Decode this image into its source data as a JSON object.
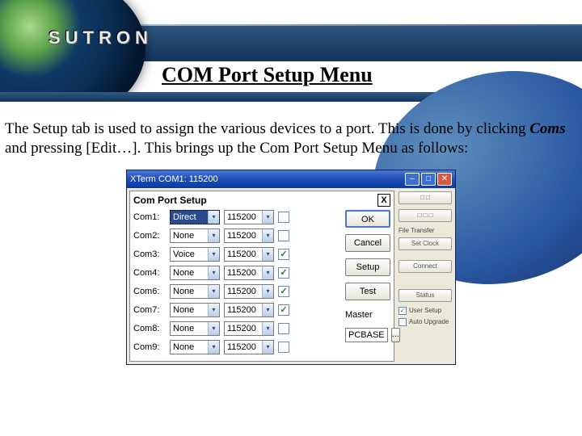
{
  "brand": "SUTRON",
  "slide_title": "COM Port Setup Menu",
  "body_text_pre": "The Setup tab is used to assign the various devices to a port. This is done by clicking ",
  "body_text_ital": "Coms",
  "body_text_post": " and pressing [Edit…]. This brings up the Com Port Setup Menu as follows:",
  "window": {
    "title": "XTerm COM1: 115200",
    "dialog_title": "Com Port Setup",
    "close_glyph": "X",
    "triangle": "▾",
    "check": "✓",
    "rows": [
      {
        "label": "Com1:",
        "type": "Direct",
        "baud": "115200",
        "checked": false,
        "selected": true
      },
      {
        "label": "Com2:",
        "type": "None",
        "baud": "115200",
        "checked": false,
        "selected": false
      },
      {
        "label": "Com3:",
        "type": "Voice",
        "baud": "115200",
        "checked": true,
        "selected": false
      },
      {
        "label": "Com4:",
        "type": "None",
        "baud": "115200",
        "checked": true,
        "selected": false
      },
      {
        "label": "Com6:",
        "type": "None",
        "baud": "115200",
        "checked": true,
        "selected": false
      },
      {
        "label": "Com7:",
        "type": "None",
        "baud": "115200",
        "checked": true,
        "selected": false
      },
      {
        "label": "Com8:",
        "type": "None",
        "baud": "115200",
        "checked": false,
        "selected": false
      },
      {
        "label": "Com9:",
        "type": "None",
        "baud": "115200",
        "checked": false,
        "selected": false
      }
    ],
    "buttons": {
      "ok": "OK",
      "cancel": "Cancel",
      "setup": "Setup",
      "test": "Test"
    },
    "master_label": "Master",
    "pcbase": "PCBASE",
    "ellipsis": "...",
    "right": {
      "r1": "",
      "r2": "",
      "file_transfer": "File Transfer",
      "set_clock": "Set Clock",
      "connect": "Connect",
      "status": "Status",
      "cb1": "User Setup",
      "cb2": "Auto Upgrade"
    }
  }
}
